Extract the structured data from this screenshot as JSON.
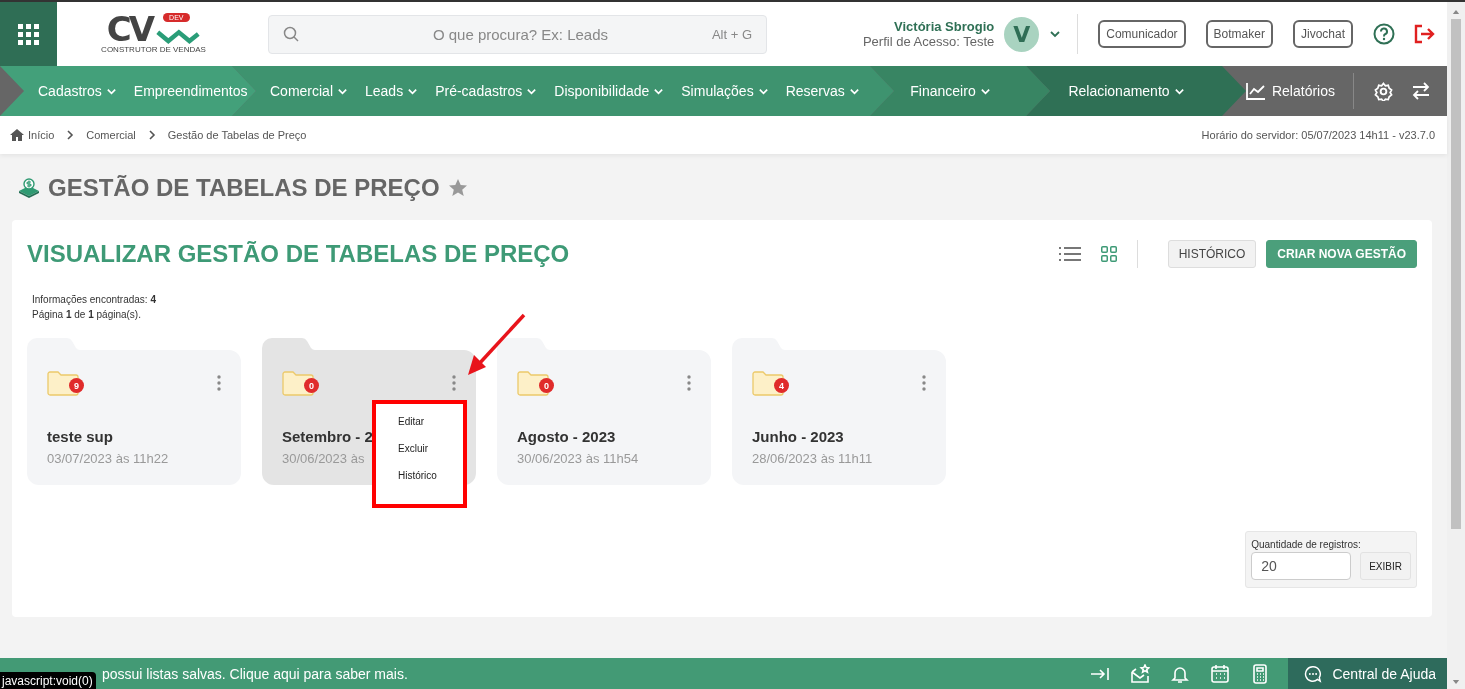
{
  "header": {
    "logo": {
      "text": "CV",
      "badge": "DEV",
      "tagline": "CONSTRUTOR DE VENDAS"
    },
    "search": {
      "placeholder": "O que procura? Ex: Leads",
      "shortcut": "Alt + G"
    },
    "user": {
      "name": "Victória Sbrogio",
      "profile": "Perfil de Acesso: Teste",
      "initial": "V"
    },
    "buttons": [
      "Comunicador",
      "Botmaker",
      "Jivochat"
    ]
  },
  "nav": {
    "segments": [
      {
        "color": "#43a07a",
        "items": [
          {
            "label": "Cadastros",
            "dropdown": true
          },
          {
            "label": "Empreendimentos",
            "dropdown": false
          }
        ]
      },
      {
        "color": "#3e936f",
        "items": [
          {
            "label": "Comercial",
            "dropdown": true
          },
          {
            "label": "Leads",
            "dropdown": true
          },
          {
            "label": "Pré-cadastros",
            "dropdown": true
          },
          {
            "label": "Disponibilidade",
            "dropdown": true
          },
          {
            "label": "Simulações",
            "dropdown": true
          },
          {
            "label": "Reservas",
            "dropdown": true
          }
        ]
      },
      {
        "color": "#388563",
        "items": [
          {
            "label": "Financeiro",
            "dropdown": true
          }
        ]
      },
      {
        "color": "#2f7055",
        "items": [
          {
            "label": "Relacionamento",
            "dropdown": true
          }
        ]
      }
    ],
    "reports": "Relatórios"
  },
  "breadcrumb": [
    "Início",
    "Comercial",
    "Gestão de Tabelas de Preço"
  ],
  "server_time": "Horário do servidor: 05/07/2023 14h11 - v23.7.0",
  "page_title": "GESTÃO DE TABELAS DE PREÇO",
  "panel": {
    "title": "VISUALIZAR GESTÃO DE TABELAS DE PREÇO",
    "views": [
      {
        "kind": "list",
        "selected": false
      },
      {
        "kind": "grid",
        "selected": true
      }
    ],
    "buttons": [
      {
        "label": "HISTÓRICO",
        "kind": "secondary"
      },
      {
        "label": "CRIAR NOVA GESTÃO",
        "kind": "primary"
      }
    ],
    "found": "Informações encontradas: **4**",
    "pages": "Página **1** de **1** página(s).",
    "cards": [
      {
        "title": "teste sup",
        "date": "03/07/2023 às 11h22",
        "count": "9",
        "selected": false
      },
      {
        "title": "Setembro - 2",
        "date": "30/06/2023 às",
        "count": "0",
        "selected": true,
        "menu": [
          "Editar",
          "Excluir",
          "Histórico"
        ]
      },
      {
        "title": "Agosto - 2023",
        "date": "30/06/2023 às 11h54",
        "count": "0",
        "selected": false
      },
      {
        "title": "Junho - 2023",
        "date": "28/06/2023 às 11h11",
        "count": "4",
        "selected": false
      }
    ],
    "page_size": {
      "label": "Quantidade de registros:",
      "value": "20",
      "button": "EXIBIR"
    }
  },
  "footer": {
    "message": "possui listas salvas. Clique aqui para saber mais.",
    "help": "Central de Ajuda"
  },
  "status_url": "javascript:void(0)"
}
